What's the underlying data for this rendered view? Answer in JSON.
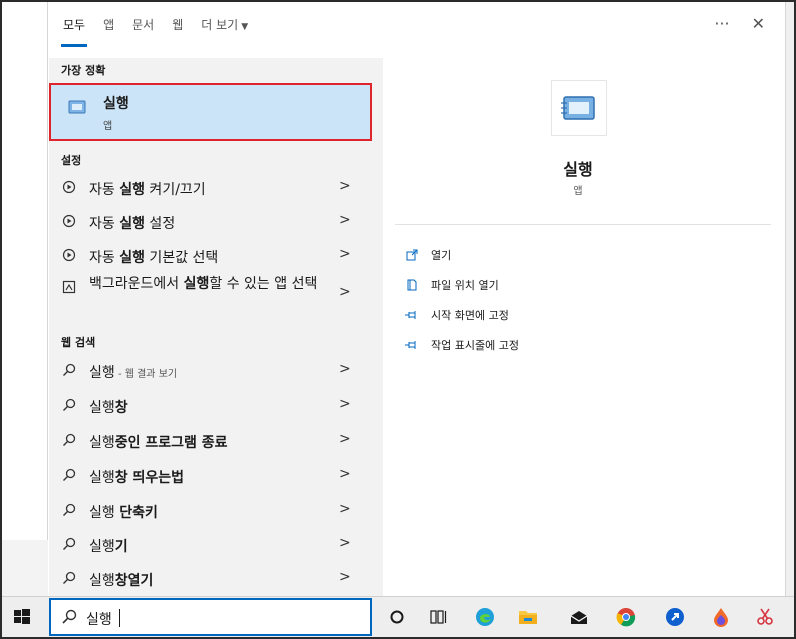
{
  "tabs": [
    {
      "label": "모두",
      "active": true
    },
    {
      "label": "앱",
      "active": false
    },
    {
      "label": "문서",
      "active": false
    },
    {
      "label": "웹",
      "active": false
    },
    {
      "label": "더 보기",
      "active": false
    }
  ],
  "topbar": {
    "more_glyph": "···",
    "close_glyph": "✕"
  },
  "sections": {
    "best_match": "가장 정확",
    "settings": "설정",
    "web_search": "웹 검색"
  },
  "best_match": {
    "title": "실행",
    "subtitle": "앱"
  },
  "settings_items": [
    {
      "pre": "자동 ",
      "bold": "실행",
      "post": " 켜기/끄기"
    },
    {
      "pre": "자동 ",
      "bold": "실행",
      "post": " 설정"
    },
    {
      "pre": "자동 ",
      "bold": "실행",
      "post": " 기본값 선택"
    },
    {
      "pre": "백그라운드에서 ",
      "bold": "실행",
      "post": "할 수 있는 앱 선택"
    }
  ],
  "web_items": [
    {
      "pre": "실행",
      "bold": "",
      "post": "",
      "muted": " - 웹 결과 보기"
    },
    {
      "pre": "실행",
      "bold": "창",
      "post": "",
      "muted": ""
    },
    {
      "pre": "실행",
      "bold": "중인 프로그램 종료",
      "post": "",
      "muted": ""
    },
    {
      "pre": "실행",
      "bold": "창 띄우는법",
      "post": "",
      "muted": ""
    },
    {
      "pre": "실행 ",
      "bold": "단축키",
      "post": "",
      "muted": ""
    },
    {
      "pre": "실행",
      "bold": "기",
      "post": "",
      "muted": ""
    },
    {
      "pre": "실행",
      "bold": "창열기",
      "post": "",
      "muted": ""
    }
  ],
  "chevron": ">",
  "detail": {
    "app_name": "실행",
    "app_type": "앱",
    "actions": [
      {
        "label": "열기",
        "icon": "open-icon"
      },
      {
        "label": "파일 위치 열기",
        "icon": "file-location-icon"
      },
      {
        "label": "시작 화면에 고정",
        "icon": "pin-icon"
      },
      {
        "label": "작업 표시줄에 고정",
        "icon": "pin-icon"
      }
    ]
  },
  "taskbar": {
    "search_value": "실행",
    "icons": [
      "start-icon",
      "cortana-icon",
      "task-view-icon",
      "edge-icon",
      "file-explorer-icon",
      "mail-icon",
      "chrome-icon",
      "app-icon",
      "paint-icon",
      "snipping-tool-icon"
    ]
  },
  "colors": {
    "accent": "#0067c0",
    "selection": "#cce4f7",
    "highlight_border": "#e0242b",
    "list_bg": "#f2f2f2"
  }
}
